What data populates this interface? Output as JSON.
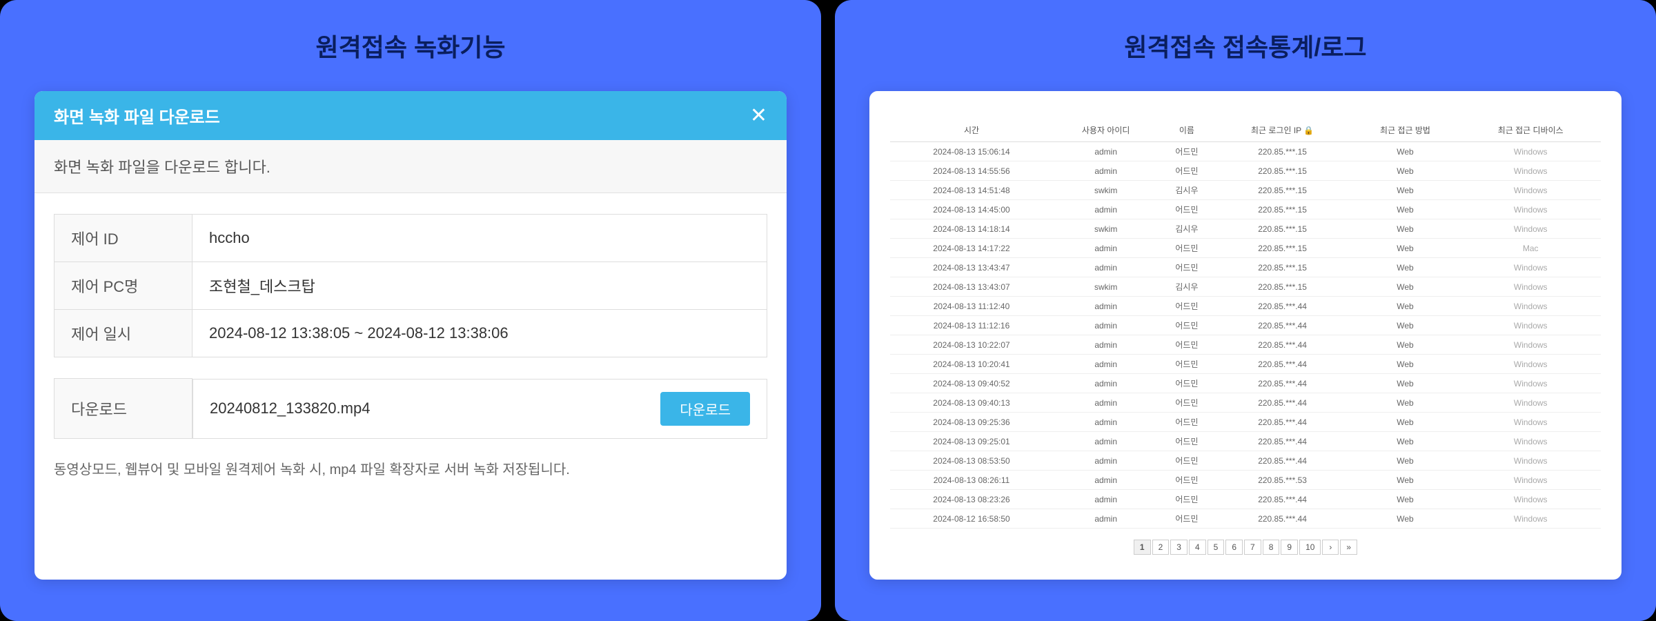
{
  "left": {
    "title": "원격접속 녹화기능",
    "dialog": {
      "header": "화면 녹화 파일 다운로드",
      "subtitle": "화면 녹화 파일을 다운로드 합니다.",
      "rows": {
        "id_label": "제어 ID",
        "id_value": "hccho",
        "pc_label": "제어 PC명",
        "pc_value": "조현철_데스크탑",
        "time_label": "제어 일시",
        "time_value": "2024-08-12 13:38:05 ~ 2024-08-12 13:38:06",
        "download_label": "다운로드",
        "download_file": "20240812_133820.mp4",
        "download_btn": "다운로드"
      },
      "footer": "동영상모드, 웹뷰어 및 모바일 원격제어 녹화 시, mp4 파일 확장자로 서버 녹화 저장됩니다."
    }
  },
  "right": {
    "title": "원격접속 접속통계/로그",
    "headers": {
      "time": "시간",
      "userid": "사용자 아이디",
      "name": "이름",
      "ip": "최근 로그인 IP",
      "method": "최근 접근 방법",
      "device": "최근 접근 디바이스"
    },
    "rows": [
      {
        "t": "2024-08-13 15:06:14",
        "u": "admin",
        "n": "어드민",
        "ip": "220.85.***.15",
        "m": "Web",
        "d": "Windows"
      },
      {
        "t": "2024-08-13 14:55:56",
        "u": "admin",
        "n": "어드민",
        "ip": "220.85.***.15",
        "m": "Web",
        "d": "Windows"
      },
      {
        "t": "2024-08-13 14:51:48",
        "u": "swkim",
        "n": "김시우",
        "ip": "220.85.***.15",
        "m": "Web",
        "d": "Windows"
      },
      {
        "t": "2024-08-13 14:45:00",
        "u": "admin",
        "n": "어드민",
        "ip": "220.85.***.15",
        "m": "Web",
        "d": "Windows"
      },
      {
        "t": "2024-08-13 14:18:14",
        "u": "swkim",
        "n": "김시우",
        "ip": "220.85.***.15",
        "m": "Web",
        "d": "Windows"
      },
      {
        "t": "2024-08-13 14:17:22",
        "u": "admin",
        "n": "어드민",
        "ip": "220.85.***.15",
        "m": "Web",
        "d": "Mac"
      },
      {
        "t": "2024-08-13 13:43:47",
        "u": "admin",
        "n": "어드민",
        "ip": "220.85.***.15",
        "m": "Web",
        "d": "Windows"
      },
      {
        "t": "2024-08-13 13:43:07",
        "u": "swkim",
        "n": "김시우",
        "ip": "220.85.***.15",
        "m": "Web",
        "d": "Windows"
      },
      {
        "t": "2024-08-13 11:12:40",
        "u": "admin",
        "n": "어드민",
        "ip": "220.85.***.44",
        "m": "Web",
        "d": "Windows"
      },
      {
        "t": "2024-08-13 11:12:16",
        "u": "admin",
        "n": "어드민",
        "ip": "220.85.***.44",
        "m": "Web",
        "d": "Windows"
      },
      {
        "t": "2024-08-13 10:22:07",
        "u": "admin",
        "n": "어드민",
        "ip": "220.85.***.44",
        "m": "Web",
        "d": "Windows"
      },
      {
        "t": "2024-08-13 10:20:41",
        "u": "admin",
        "n": "어드민",
        "ip": "220.85.***.44",
        "m": "Web",
        "d": "Windows"
      },
      {
        "t": "2024-08-13 09:40:52",
        "u": "admin",
        "n": "어드민",
        "ip": "220.85.***.44",
        "m": "Web",
        "d": "Windows"
      },
      {
        "t": "2024-08-13 09:40:13",
        "u": "admin",
        "n": "어드민",
        "ip": "220.85.***.44",
        "m": "Web",
        "d": "Windows"
      },
      {
        "t": "2024-08-13 09:25:36",
        "u": "admin",
        "n": "어드민",
        "ip": "220.85.***.44",
        "m": "Web",
        "d": "Windows"
      },
      {
        "t": "2024-08-13 09:25:01",
        "u": "admin",
        "n": "어드민",
        "ip": "220.85.***.44",
        "m": "Web",
        "d": "Windows"
      },
      {
        "t": "2024-08-13 08:53:50",
        "u": "admin",
        "n": "어드민",
        "ip": "220.85.***.44",
        "m": "Web",
        "d": "Windows"
      },
      {
        "t": "2024-08-13 08:26:11",
        "u": "admin",
        "n": "어드민",
        "ip": "220.85.***.53",
        "m": "Web",
        "d": "Windows"
      },
      {
        "t": "2024-08-13 08:23:26",
        "u": "admin",
        "n": "어드민",
        "ip": "220.85.***.44",
        "m": "Web",
        "d": "Windows"
      },
      {
        "t": "2024-08-12 16:58:50",
        "u": "admin",
        "n": "어드민",
        "ip": "220.85.***.44",
        "m": "Web",
        "d": "Windows"
      }
    ],
    "pagination": [
      "1",
      "2",
      "3",
      "4",
      "5",
      "6",
      "7",
      "8",
      "9",
      "10",
      "›",
      "»"
    ]
  }
}
